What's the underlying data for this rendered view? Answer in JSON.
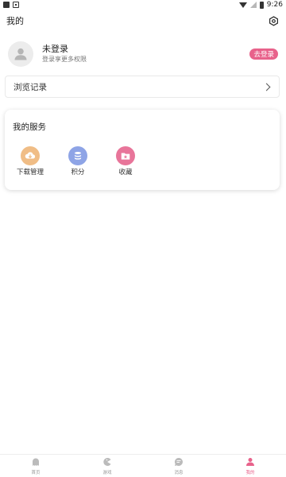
{
  "status_bar": {
    "time": "9:26"
  },
  "header": {
    "title": "我的"
  },
  "profile": {
    "name": "未登录",
    "subtitle": "登录享更多权限",
    "login_button": "去登录"
  },
  "history": {
    "label": "浏览记录"
  },
  "services": {
    "title": "我的服务",
    "items": [
      {
        "label": "下载管理",
        "icon": "cloud-download-icon",
        "color": "#f0bd86"
      },
      {
        "label": "积分",
        "icon": "coins-stack-icon",
        "color": "#8ea4e6"
      },
      {
        "label": "收藏",
        "icon": "star-folder-icon",
        "color": "#e8759a"
      }
    ]
  },
  "bottom_nav": {
    "items": [
      {
        "label": "首页",
        "icon": "ghost-icon"
      },
      {
        "label": "游戏",
        "icon": "pacman-icon"
      },
      {
        "label": "消息",
        "icon": "chat-icon"
      },
      {
        "label": "我的",
        "icon": "user-icon",
        "active": true
      }
    ],
    "active_color": "#e8628b",
    "inactive_color": "#bbbbbb"
  }
}
